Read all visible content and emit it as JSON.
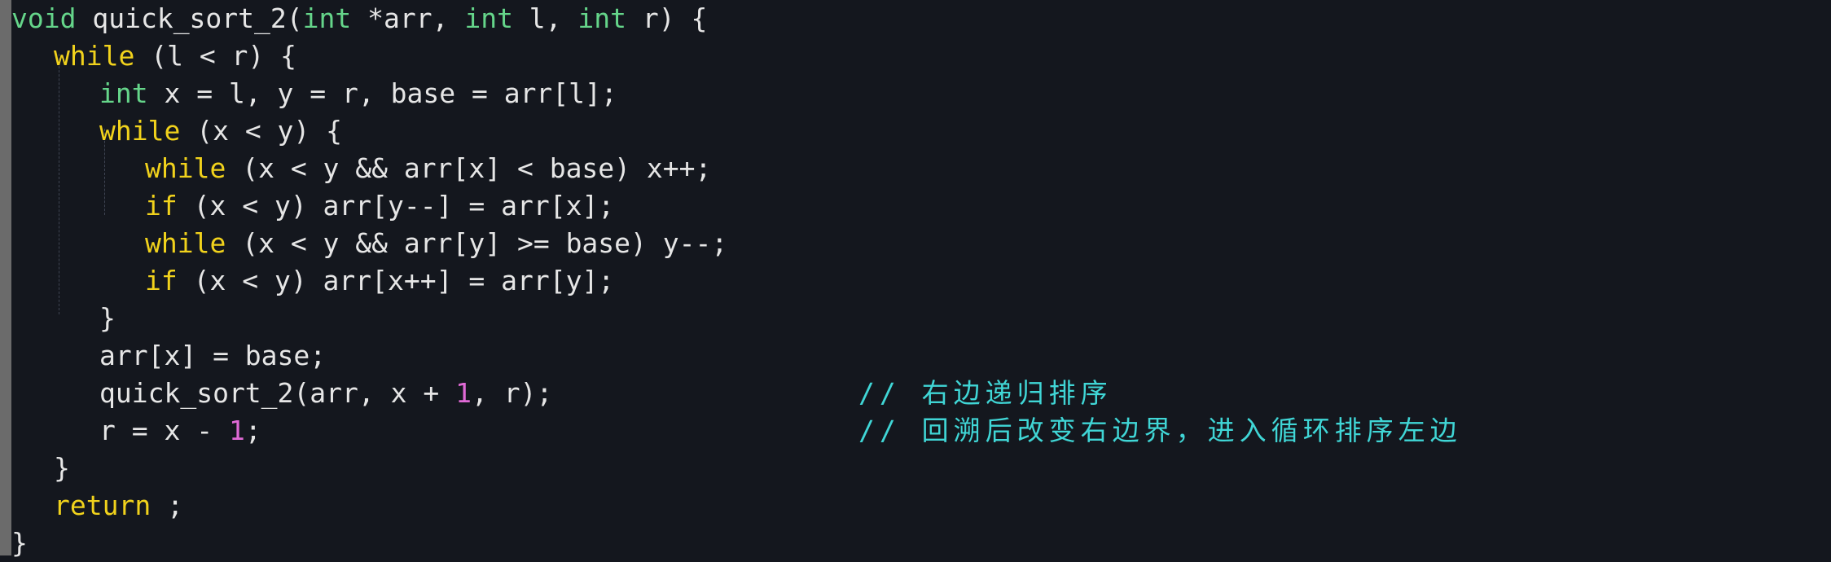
{
  "colors": {
    "background": "#14171e",
    "text": "#e6e6e6",
    "type_keyword": "#65d58a",
    "control_keyword": "#f1d21c",
    "number": "#e06ad6",
    "comment": "#40d6d6",
    "gutter": "#6b6b6b"
  },
  "code": {
    "l1": {
      "kw1": "void",
      "t1": " quick_sort_2(",
      "kw2": "int",
      "t2": " *arr, ",
      "kw3": "int",
      "t3": " l, ",
      "kw4": "int",
      "t4": " r) {"
    },
    "l2": {
      "kw": "while",
      "t": " (l < r) {"
    },
    "l3": {
      "kw": "int",
      "t": " x = l, y = r, base = arr[l];"
    },
    "l4": {
      "kw": "while",
      "t": " (x < y) {"
    },
    "l5": {
      "kw": "while",
      "t": " (x < y && arr[x] < base) x++;"
    },
    "l6": {
      "kw": "if",
      "t": " (x < y) arr[y--] = arr[x];"
    },
    "l7": {
      "kw": "while",
      "t": " (x < y && arr[y] >= base) y--;"
    },
    "l8": {
      "kw": "if",
      "t": " (x < y) arr[x++] = arr[y];"
    },
    "l9": {
      "t": "}"
    },
    "l10": {
      "t": "arr[x] = base;"
    },
    "l11": {
      "t1": "quick_sort_2(arr, x + ",
      "num": "1",
      "t2": ", r);",
      "comment": "// 右边递归排序"
    },
    "l12": {
      "t1": "r = x - ",
      "num": "1",
      "t2": ";",
      "comment": "// 回溯后改变右边界，进入循环排序左边"
    },
    "l13": {
      "t": "}"
    },
    "l14": {
      "kw": "return",
      "t": " ;"
    },
    "l15": {
      "t": "}"
    }
  }
}
